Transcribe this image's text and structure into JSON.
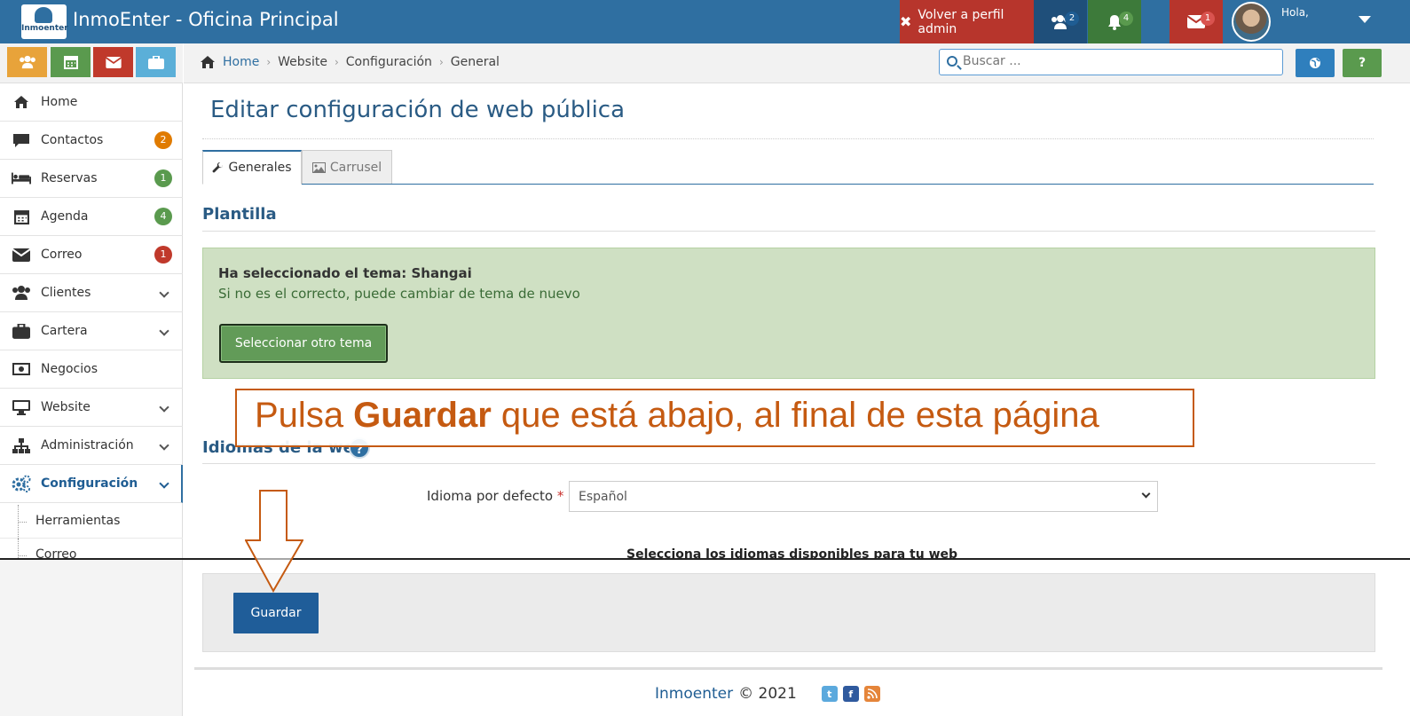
{
  "header": {
    "logo_text": "Inmoenter",
    "app_title": "InmoEnter - Oficina Principal",
    "admin_button": "Volver a perfil admin",
    "counters": [
      {
        "name": "users",
        "count": "2",
        "color": "#1f5d93"
      },
      {
        "name": "notifications",
        "count": "4",
        "color": "#5a9a4e"
      },
      {
        "name": "mail",
        "count": "1",
        "color": "#c0392b"
      }
    ],
    "greeting": "Hola,"
  },
  "quick_buttons": [
    {
      "icon": "users-icon",
      "color": "#e8a33a"
    },
    {
      "icon": "calendar-icon",
      "color": "#5a9a4e"
    },
    {
      "icon": "envelope-icon",
      "color": "#c0392b"
    },
    {
      "icon": "briefcase-icon",
      "color": "#5bafd8"
    }
  ],
  "sidebar": {
    "items": [
      {
        "label": "Home",
        "icon": "home-icon"
      },
      {
        "label": "Contactos",
        "icon": "comment-icon",
        "badge": "2",
        "badge_color": "#e07b00"
      },
      {
        "label": "Reservas",
        "icon": "bed-icon",
        "badge": "1",
        "badge_color": "#5a9a4e"
      },
      {
        "label": "Agenda",
        "icon": "calendar-icon",
        "badge": "4",
        "badge_color": "#5a9a4e"
      },
      {
        "label": "Correo",
        "icon": "envelope-icon",
        "badge": "1",
        "badge_color": "#c0392b"
      },
      {
        "label": "Clientes",
        "icon": "users-icon"
      },
      {
        "label": "Cartera",
        "icon": "briefcase-icon"
      },
      {
        "label": "Negocios",
        "icon": "money-icon"
      },
      {
        "label": "Website",
        "icon": "desktop-icon"
      },
      {
        "label": "Administración",
        "icon": "sitemap-icon"
      },
      {
        "label": "Configuración",
        "icon": "cogs-icon"
      }
    ],
    "sub_items": [
      "Herramientas",
      "Correo"
    ]
  },
  "breadcrumb": [
    "Home",
    "Website",
    "Configuración",
    "General"
  ],
  "search": {
    "placeholder": "Buscar ..."
  },
  "right_buttons": [
    {
      "icon": "globe-icon",
      "color": "#2f7fbd"
    },
    {
      "icon": "question-icon",
      "label": "?",
      "color": "#5a9a4e"
    }
  ],
  "page": {
    "title": "Editar configuración de web pública",
    "tabs": [
      {
        "label": "Generales",
        "icon": "wrench-icon"
      },
      {
        "label": "Carrusel",
        "icon": "image-icon"
      }
    ],
    "section_template": "Plantilla",
    "alert_title": "Ha seleccionado el tema: Shangai",
    "alert_text": "Si no es el correcto, puede cambiar de tema de nuevo",
    "theme_button": "Seleccionar otro tema",
    "callout": {
      "pre": "Pulsa ",
      "bold": "Guardar",
      "post": " que está abajo, al final de esta página"
    },
    "section_languages": "Idiomas de la web",
    "help": "?",
    "default_language_label": "Idioma por defecto",
    "required_mark": "*",
    "default_language_value": "Español",
    "available_languages_label": "Selecciona los idiomas disponibles para tu web",
    "save_button": "Guardar"
  },
  "footer": {
    "brand": "Inmoenter",
    "copyright": "© 2021"
  }
}
